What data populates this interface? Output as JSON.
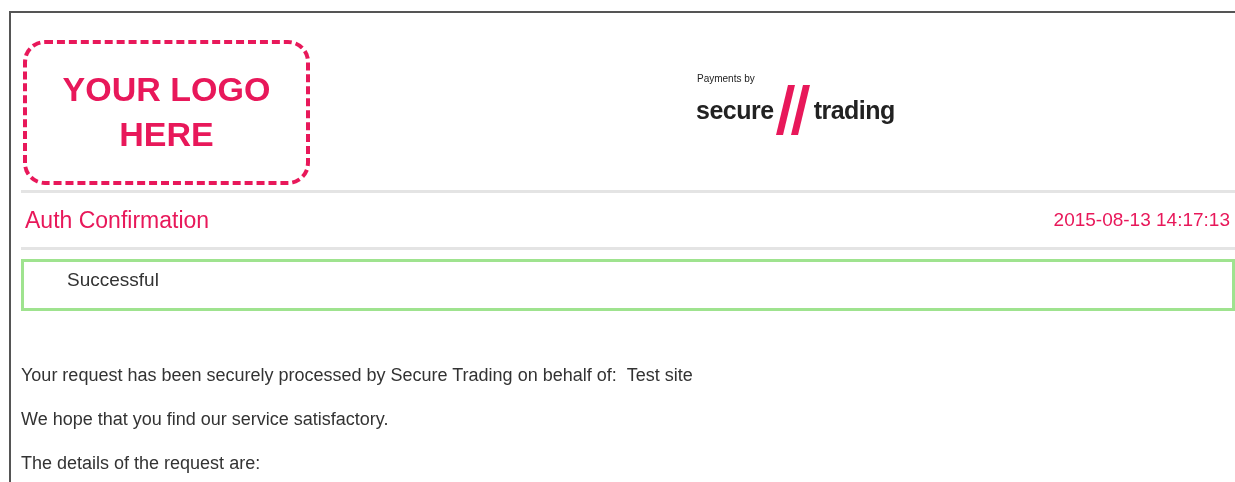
{
  "header": {
    "logo_placeholder": {
      "lines": [
        "YOUR LOGO",
        "HERE"
      ]
    },
    "brand": {
      "tagline": "Payments by",
      "word_1": "secure",
      "word_2": "trading"
    }
  },
  "title": "Auth Confirmation",
  "timestamp": "2015-08-13 14:17:13",
  "status": {
    "kind": "success",
    "message": "Successful"
  },
  "paragraphs": [
    {
      "text": "Your request has been securely processed by Secure Trading on behalf of:",
      "value": "Test site"
    },
    {
      "text": "We hope that you find our service satisfactory."
    },
    {
      "text": "The details of the request are:"
    }
  ]
}
